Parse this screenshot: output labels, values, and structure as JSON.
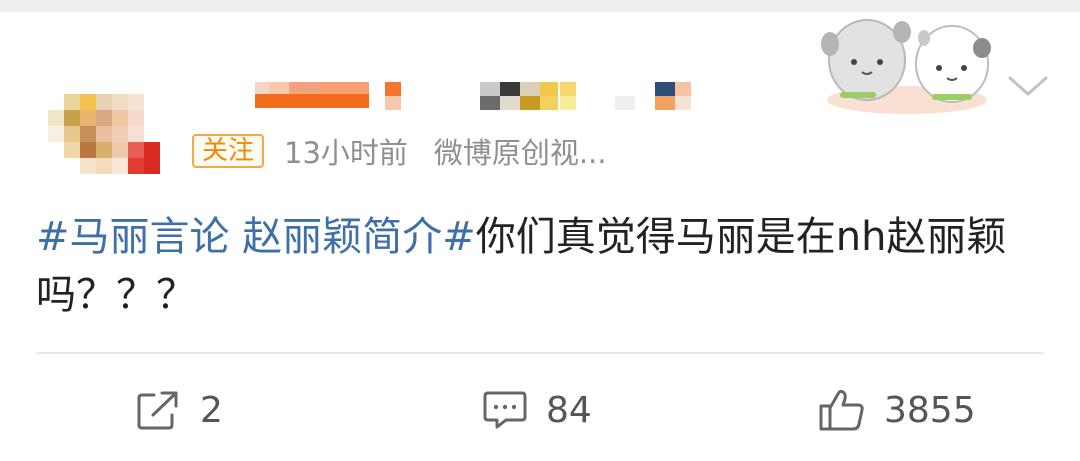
{
  "post": {
    "follow_label": "关注",
    "time_label": "13小时前",
    "source_label": "微博原创视...",
    "hashtag_text": "#马丽言论 赵丽颖简介#",
    "body_text": "你们真觉得马丽是在nh赵丽颖吗？？？"
  },
  "actions": {
    "repost_count": "2",
    "comment_count": "84",
    "like_count": "3855"
  },
  "icons": {
    "repost": "share-icon",
    "comment": "comment-icon",
    "like": "thumbs-up-icon",
    "more": "chevron-down-icon",
    "sticker": "sticker-image"
  },
  "colors": {
    "hashtag": "#3f6fa8",
    "follow_border": "#f3a84c",
    "follow_text": "#f08a00",
    "meta_text": "#8f8f8f",
    "body_text": "#222222"
  }
}
